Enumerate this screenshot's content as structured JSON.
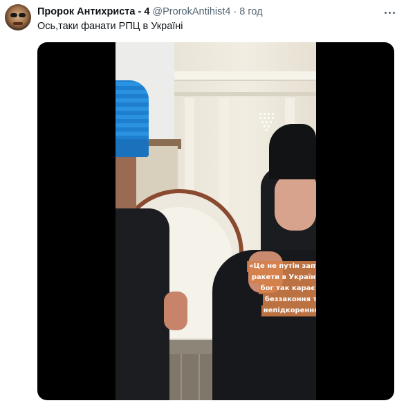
{
  "tweet": {
    "display_name": "Пророк Антихриста - 4",
    "handle": "@ProrokAntihist4",
    "separator": "·",
    "time": "8 год",
    "text": "Ось,таки фанати РПЦ в Україні",
    "avatar_icon": "user-avatar",
    "more_icon": "more-horizontal-icon"
  },
  "media": {
    "type": "video",
    "caption_lines": [
      "«Це не путін запускає",
      "ракети в Україну, це",
      "бог так карає за",
      "беззаконня та",
      "непідкорення»"
    ],
    "watermark_icon": "channel-logo-icon",
    "colors": {
      "caption_bg": "#d68048",
      "caption_text": "#ffffff",
      "letterbox": "#000000"
    }
  }
}
